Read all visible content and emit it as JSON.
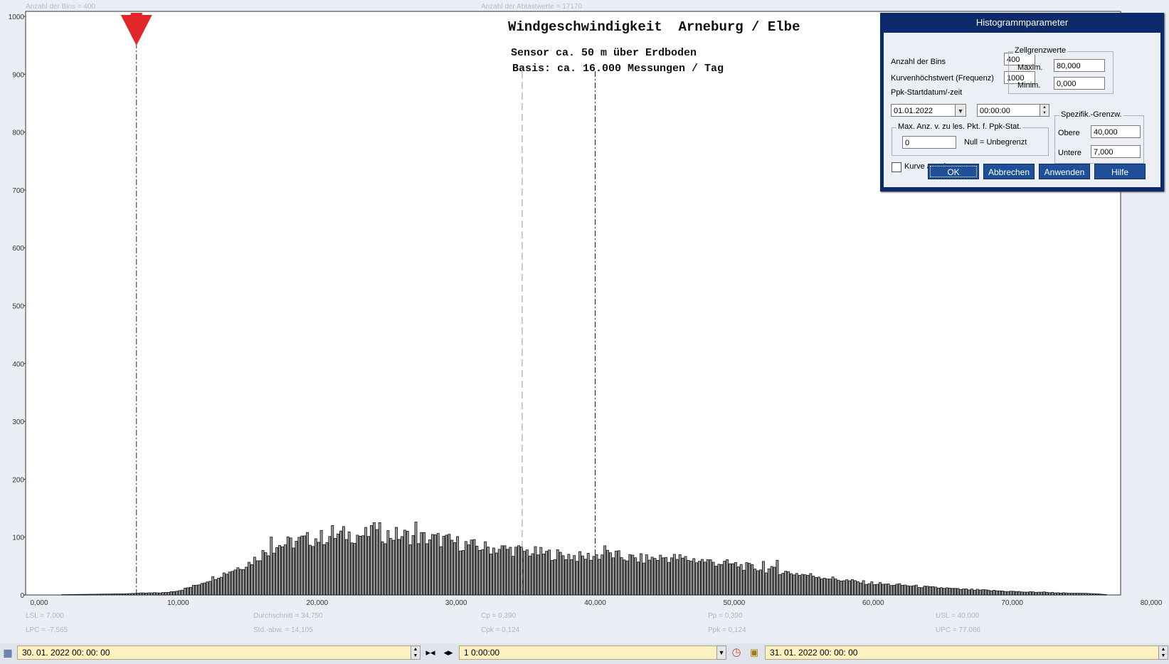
{
  "header": {
    "bins_text": "Anzahl der Bins =   400",
    "samples_text": "Anzahl der Abtastwerte = 17170"
  },
  "chart_data": {
    "type": "bar",
    "title": "Windgeschwindigkeit  Arneburg / Elbe",
    "subtitle_lines": [
      "Sensor ca. 50 m über Erdboden",
      "Basis: ca. 16.000 Messungen / Tag"
    ],
    "xlim": [
      0,
      80
    ],
    "ylim": [
      0,
      1000
    ],
    "x_tick_labels": [
      "0,000",
      "10,000",
      "20,000",
      "30,000",
      "40,000",
      "50,000",
      "60,000",
      "70,000",
      "80,000"
    ],
    "y_tick_labels": [
      "0",
      "100",
      "200",
      "300",
      "400",
      "500",
      "600",
      "700",
      "800",
      "900",
      "1000"
    ],
    "bin_width": 0.2,
    "lsl": 7.0,
    "usl": 40.0,
    "mean": 34.75,
    "bin_profile": {
      "x": [
        0,
        3,
        6,
        7,
        9,
        10,
        11,
        12,
        13,
        14,
        15,
        16,
        17,
        18,
        19,
        20,
        21,
        22,
        23,
        24,
        25,
        26,
        27,
        28,
        29,
        30,
        31,
        32,
        33,
        34,
        35,
        36,
        37,
        38,
        39,
        40,
        41,
        42,
        43,
        44,
        45,
        46,
        47,
        48,
        49,
        50,
        51,
        52,
        53,
        54,
        55,
        56,
        57,
        58,
        59,
        60,
        61,
        62,
        63,
        64,
        65,
        66,
        67,
        68,
        69,
        70,
        71,
        72,
        73,
        74,
        75,
        76,
        77
      ],
      "y": [
        0,
        1,
        2,
        3,
        4,
        8,
        15,
        25,
        35,
        45,
        55,
        72,
        85,
        90,
        95,
        98,
        102,
        105,
        103,
        105,
        104,
        103,
        100,
        97,
        95,
        90,
        85,
        82,
        80,
        78,
        75,
        72,
        70,
        68,
        65,
        68,
        70,
        65,
        62,
        63,
        65,
        63,
        61,
        58,
        55,
        52,
        48,
        45,
        42,
        38,
        35,
        32,
        28,
        25,
        22,
        20,
        18,
        17,
        15,
        13,
        12,
        10,
        9,
        8,
        7,
        6,
        5,
        5,
        4,
        3,
        3,
        2,
        0
      ]
    },
    "bar_highlights": [
      {
        "x": 16.6,
        "y": 100
      },
      {
        "x": 21.0,
        "y": 120
      },
      {
        "x": 24.0,
        "y": 125
      },
      {
        "x": 24.4,
        "y": 125
      },
      {
        "x": 27.0,
        "y": 126
      },
      {
        "x": 40.6,
        "y": 85
      },
      {
        "x": 52.0,
        "y": 58
      },
      {
        "x": 53.0,
        "y": 60
      }
    ],
    "markers": [
      {
        "x": 7.0,
        "style": "dashdot",
        "name": "LSL"
      },
      {
        "x": 34.75,
        "style": "dashed",
        "name": "Durchschnitt"
      },
      {
        "x": 40.0,
        "style": "dashdot",
        "name": "USL"
      }
    ],
    "grid": false
  },
  "stats": {
    "lsl": "LSL = 7,000",
    "lpc": "LPC = -7,565",
    "mean": "Durchschnitt  = 34,750",
    "std": "Std.-abw. = 14,105",
    "cp": "Cp  = 0,390",
    "cpk": "Cpk = 0,124",
    "pp": "Pp  = 0,390",
    "ppk": "Ppk = 0,124",
    "usl": "USL = 40,000",
    "upc": "UPC = 77,066"
  },
  "dialog": {
    "title": "Histogrammparameter",
    "bins_label": "Anzahl der Bins",
    "bins_value": "400",
    "curve_max_label": "Kurvenhöchstwert (Frequenz)",
    "curve_max_value": "1000",
    "ppk_start_label": "Ppk-Startdatum/-zeit",
    "date_value": "01.01.2022",
    "time_value": "00:00:00",
    "max_group_title": "Max. Anz. v. zu les. Pkt. f. Ppk-Stat.",
    "max_value": "0",
    "null_hint": "Null = Unbegrenzt",
    "cell_limits_title": "Zellgrenzwerte",
    "max_label": "Maxim.",
    "max_cell_value": "80,000",
    "min_label": "Minim.",
    "min_cell_value": "0,000",
    "spec_title": "Spezifik.-Grenzw.",
    "upper_label": "Obere",
    "upper_value": "40,000",
    "lower_label": "Untere",
    "lower_value": "7,000",
    "show_curve_label": "Kurve anzeigen",
    "ok_label": "OK",
    "cancel_label": "Abbrechen",
    "apply_label": "Anwenden",
    "help_label": "Hilfe"
  },
  "bottom_bar": {
    "start_value": "30. 01. 2022   00: 00: 00",
    "interval_value": "1 0:00:00",
    "end_value": "31. 01. 2022   00: 00: 00"
  }
}
